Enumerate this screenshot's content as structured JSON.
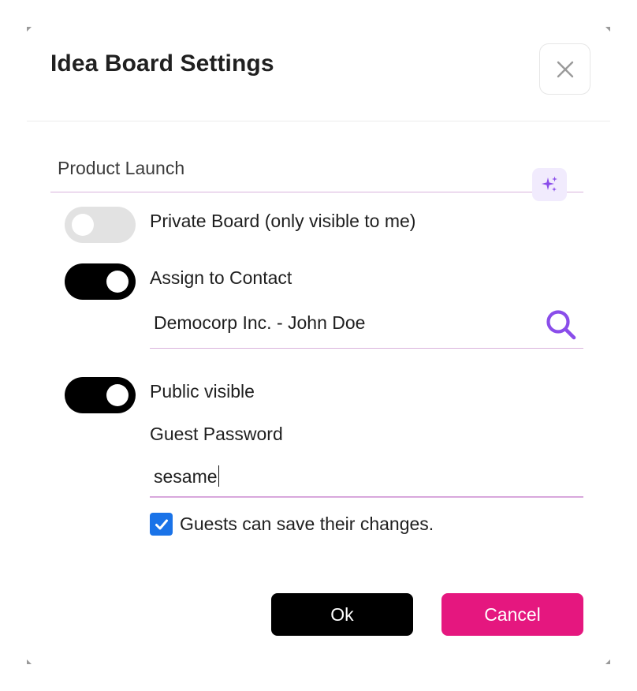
{
  "dialog": {
    "title": "Idea Board Settings",
    "close_icon": "close-icon"
  },
  "board_name": {
    "value": "Product Launch",
    "ai_icon": "sparkles-icon"
  },
  "private_board": {
    "label": "Private Board (only visible to me)",
    "enabled": false
  },
  "assign_contact": {
    "label": "Assign to Contact",
    "enabled": true,
    "contact_value": "Democorp Inc. - John Doe",
    "search_icon": "search-icon"
  },
  "public_visible": {
    "label": "Public visible",
    "enabled": true
  },
  "guest_password": {
    "label": "Guest Password",
    "value": "sesame"
  },
  "guests_save": {
    "label": "Guests can save their changes.",
    "checked": true
  },
  "buttons": {
    "ok": "Ok",
    "cancel": "Cancel"
  },
  "colors": {
    "accent_pink": "#e5177f",
    "accent_purple": "#8a4dea",
    "checkbox_blue": "#1a73e8",
    "underline": "#d9b3dc"
  }
}
